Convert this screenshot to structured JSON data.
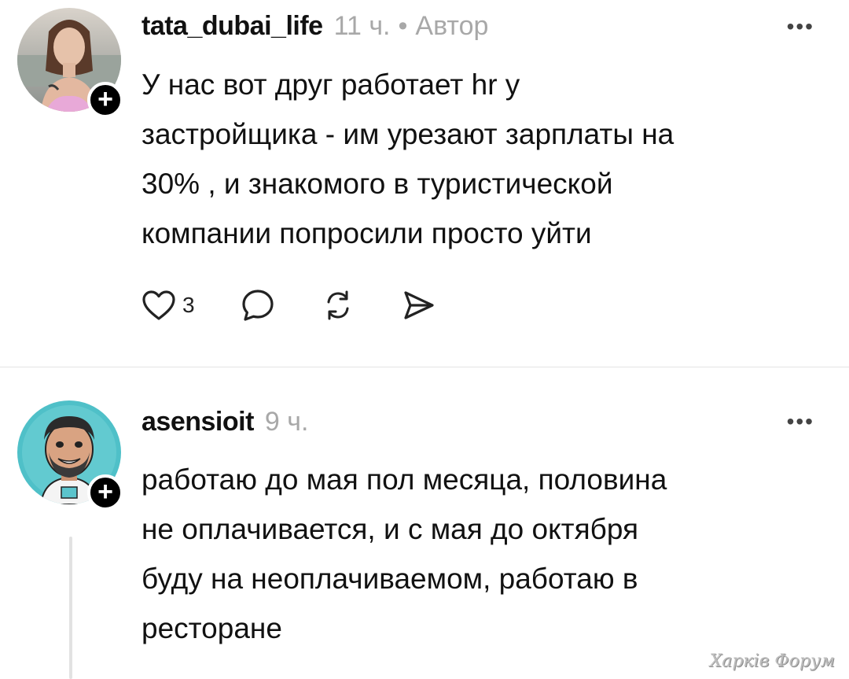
{
  "comments": [
    {
      "username": "tata_dubai_life",
      "time": "11 ч.",
      "separator": "•",
      "role": "Автор",
      "text": "У нас вот друг работает hr у\nзастройщика - им урезают зарплаты на\n30% , и знакомого в туристической\nкомпании попросили просто уйти",
      "more": "•••",
      "follow_symbol": "+",
      "likes": "3",
      "icons": [
        "heart-icon",
        "comment-icon",
        "repost-icon",
        "share-icon"
      ]
    },
    {
      "username": "asensioit",
      "time": "9 ч.",
      "text": "работаю до мая пол месяца, половина\nне оплачивается, и с мая до октября\nбуду на неоплачиваемом, работаю в\nресторане",
      "more": "•••",
      "follow_symbol": "+"
    }
  ],
  "watermark": "Харків Форум",
  "colors": {
    "text": "#111111",
    "muted": "#a8a8a8",
    "divider": "#e4e4e4",
    "badge": "#000000"
  }
}
